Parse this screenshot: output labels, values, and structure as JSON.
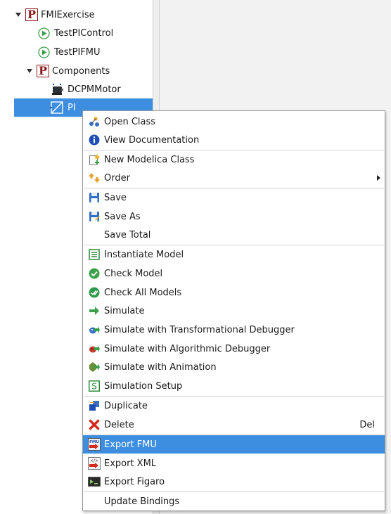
{
  "tree": {
    "items": [
      {
        "label": "FMIExercise"
      },
      {
        "label": "TestPIControl"
      },
      {
        "label": "TestPIFMU"
      },
      {
        "label": "Components"
      },
      {
        "label": "DCPMMotor"
      },
      {
        "label": "PI"
      }
    ]
  },
  "menu": {
    "items": [
      {
        "label": "Open Class"
      },
      {
        "label": "View Documentation"
      },
      {
        "label": "New Modelica Class"
      },
      {
        "label": "Order"
      },
      {
        "label": "Save"
      },
      {
        "label": "Save As"
      },
      {
        "label": "Save Total"
      },
      {
        "label": "Instantiate Model"
      },
      {
        "label": "Check Model"
      },
      {
        "label": "Check All Models"
      },
      {
        "label": "Simulate"
      },
      {
        "label": "Simulate with Transformational Debugger"
      },
      {
        "label": "Simulate with Algorithmic Debugger"
      },
      {
        "label": "Simulate with Animation"
      },
      {
        "label": "Simulation Setup"
      },
      {
        "label": "Duplicate"
      },
      {
        "label": "Delete",
        "shortcut": "Del"
      },
      {
        "label": "Export FMU"
      },
      {
        "label": "Export XML"
      },
      {
        "label": "Export Figaro"
      },
      {
        "label": "Update Bindings"
      }
    ]
  },
  "colors": {
    "selection": "#3d8ee0",
    "package_red": "#8b1a1a",
    "play_green": "#3aa04a"
  }
}
